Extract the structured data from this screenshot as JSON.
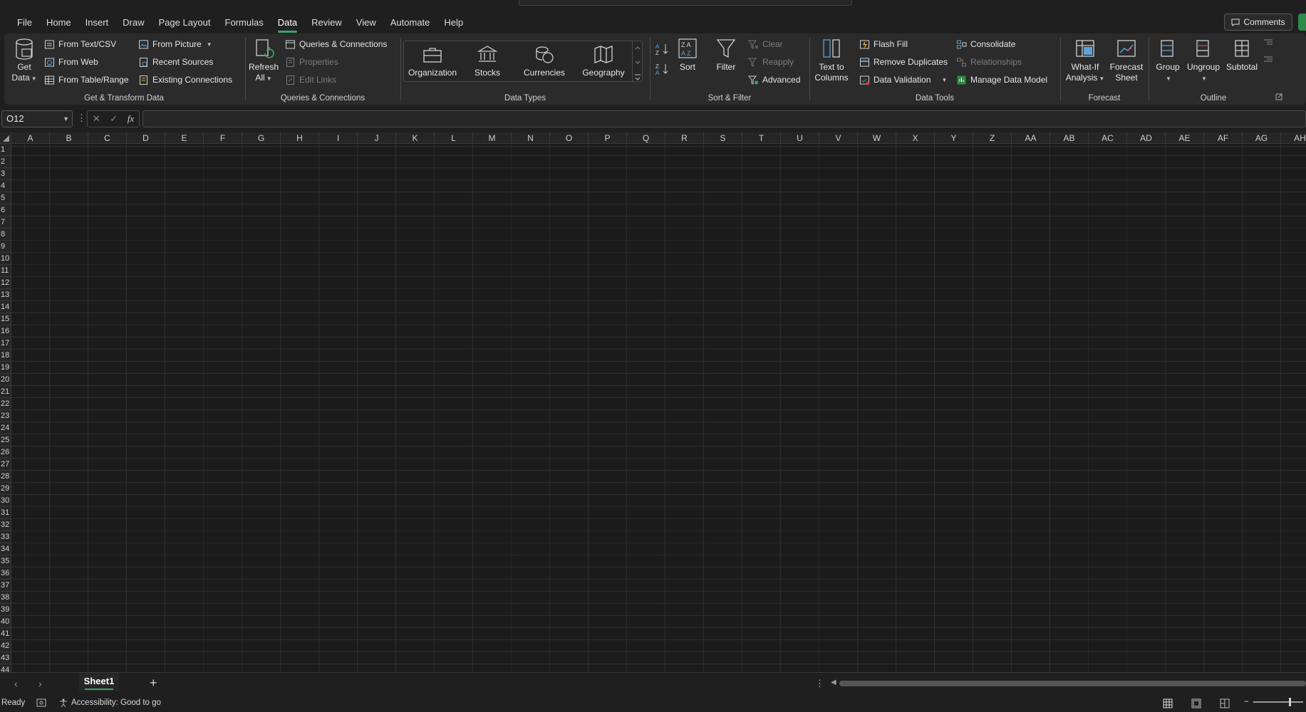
{
  "menu": {
    "tabs": [
      "File",
      "Home",
      "Insert",
      "Draw",
      "Page Layout",
      "Formulas",
      "Data",
      "Review",
      "View",
      "Automate",
      "Help"
    ],
    "active_tab": "Data",
    "comments_label": "Comments"
  },
  "ribbon": {
    "get_transform": {
      "label": "Get & Transform Data",
      "get_data": "Get Data",
      "from_text_csv": "From Text/CSV",
      "from_web": "From Web",
      "from_table_range": "From Table/Range",
      "from_picture": "From Picture",
      "recent_sources": "Recent Sources",
      "existing_connections": "Existing Connections"
    },
    "queries": {
      "label": "Queries & Connections",
      "refresh_all": "Refresh All",
      "queries_connections": "Queries & Connections",
      "properties": "Properties",
      "edit_links": "Edit Links"
    },
    "data_types": {
      "label": "Data Types",
      "items": [
        "Organization",
        "Stocks",
        "Currencies",
        "Geography"
      ]
    },
    "sort_filter": {
      "label": "Sort & Filter",
      "sort": "Sort",
      "filter": "Filter",
      "clear": "Clear",
      "reapply": "Reapply",
      "advanced": "Advanced"
    },
    "data_tools": {
      "label": "Data Tools",
      "text_to_columns": "Text to Columns",
      "flash_fill": "Flash Fill",
      "remove_duplicates": "Remove Duplicates",
      "data_validation": "Data Validation",
      "consolidate": "Consolidate",
      "relationships": "Relationships",
      "manage_data_model": "Manage Data Model"
    },
    "forecast": {
      "label": "Forecast",
      "what_if": "What-If Analysis",
      "forecast_sheet": "Forecast Sheet"
    },
    "outline": {
      "label": "Outline",
      "group": "Group",
      "ungroup": "Ungroup",
      "subtotal": "Subtotal"
    }
  },
  "formula_bar": {
    "name_box": "O12",
    "formula": ""
  },
  "grid": {
    "columns": [
      "A",
      "B",
      "C",
      "D",
      "E",
      "F",
      "G",
      "H",
      "I",
      "J",
      "K",
      "L",
      "M",
      "N",
      "O",
      "P",
      "Q",
      "R",
      "S",
      "T",
      "U",
      "V",
      "W",
      "X",
      "Y",
      "Z",
      "AA",
      "AB",
      "AC",
      "AD",
      "AE",
      "AF",
      "AG",
      "AH"
    ],
    "rows": [
      "1",
      "2",
      "3",
      "4",
      "5",
      "6",
      "7",
      "8",
      "9",
      "10",
      "11",
      "12",
      "13",
      "14",
      "15",
      "16",
      "17",
      "18",
      "19",
      "20",
      "21",
      "22",
      "23",
      "24",
      "25",
      "26",
      "27",
      "28",
      "29",
      "30",
      "31",
      "32",
      "33",
      "34",
      "35",
      "36",
      "37",
      "38",
      "39",
      "40",
      "41",
      "42",
      "43",
      "44"
    ]
  },
  "sheets": {
    "active": "Sheet1"
  },
  "status": {
    "ready": "Ready",
    "accessibility": "Accessibility: Good to go"
  },
  "colors": {
    "accent": "#3ea36a",
    "background": "#1f1f1f",
    "ribbon": "#2b2b2b"
  }
}
